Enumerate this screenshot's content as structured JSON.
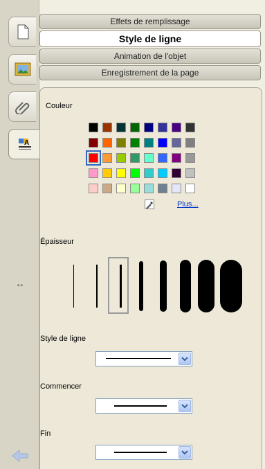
{
  "sections": [
    {
      "label": "Effets de remplissage",
      "active": false
    },
    {
      "label": "Style de ligne",
      "active": true
    },
    {
      "label": "Animation de l'objet",
      "active": false
    },
    {
      "label": "Enregistrement de la page",
      "active": false
    }
  ],
  "rail": {
    "tabs": [
      "page-icon",
      "image-icon",
      "paperclip-icon",
      "properties-icon"
    ],
    "resize_glyph": "↔"
  },
  "color": {
    "label": "Couleur",
    "rows": [
      [
        "#000000",
        "#993300",
        "#003333",
        "#006600",
        "#000080",
        "#333399",
        "#4b0082",
        "#333333"
      ],
      [
        "#800000",
        "#ff6600",
        "#808000",
        "#008000",
        "#008080",
        "#0000ff",
        "#666699",
        "#808080"
      ],
      [
        "#ff0000",
        "#ff9933",
        "#99cc00",
        "#339966",
        "#66ffcc",
        "#3366ff",
        "#800080",
        "#999999"
      ],
      [
        "#ff99cc",
        "#ffcc00",
        "#ffff00",
        "#00ff00",
        "#33cccc",
        "#00ccff",
        "#330033",
        "#c0c0c0"
      ],
      [
        "#ffcccc",
        "#ccaa88",
        "#ffffcc",
        "#99ff99",
        "#99dddd",
        "#708090",
        "#e6e6fa",
        "#ffffff"
      ]
    ],
    "selected": [
      2,
      0
    ],
    "more_link": "Plus..."
  },
  "thickness": {
    "label": "Épaisseur",
    "options": [
      1,
      2,
      3,
      6,
      10,
      16,
      24,
      32
    ],
    "selected_index": 2
  },
  "line_style": {
    "label": "Style de ligne"
  },
  "start": {
    "label": "Commencer"
  },
  "end": {
    "label": "Fin"
  }
}
